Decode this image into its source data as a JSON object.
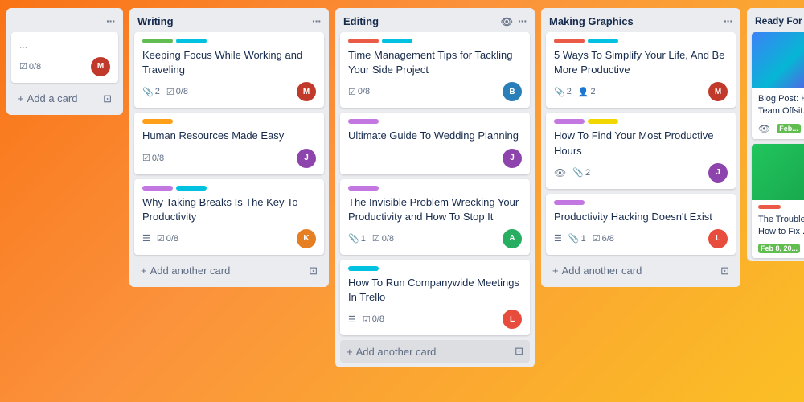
{
  "columns": [
    {
      "id": "col-left-partial",
      "title": "...",
      "partial": true,
      "cards": [
        {
          "labels": [],
          "title": "...",
          "badges": {
            "checks": "0/8"
          },
          "hasAvatar": true,
          "avatarColor": "#c0392b"
        }
      ],
      "addCardLabel": "Add a card"
    },
    {
      "id": "col-writing",
      "title": "Writing",
      "cards": [
        {
          "labels": [
            {
              "color": "green"
            },
            {
              "color": "teal"
            }
          ],
          "title": "Keeping Focus While Working and Traveling",
          "badges": {
            "paperclip": "2",
            "checks": "0/8"
          },
          "hasAvatar": true,
          "avatarColor": "#c0392b"
        },
        {
          "labels": [
            {
              "color": "orange"
            }
          ],
          "title": "Human Resources Made Easy",
          "badges": {
            "checks": "0/8"
          },
          "hasAvatar": true,
          "avatarColor": "#8e44ad"
        },
        {
          "labels": [
            {
              "color": "purple"
            },
            {
              "color": "teal"
            }
          ],
          "title": "Why Taking Breaks Is The Key To Productivity",
          "badges": {
            "list": true,
            "checks": "0/8"
          },
          "hasAvatar": true,
          "avatarColor": "#e67e22"
        }
      ],
      "addCardLabel": "Add another card"
    },
    {
      "id": "col-editing",
      "title": "Editing",
      "hasEye": true,
      "cards": [
        {
          "labels": [
            {
              "color": "red"
            },
            {
              "color": "teal"
            }
          ],
          "title": "Time Management Tips for Tackling Your Side Project",
          "badges": {
            "checks": "0/8"
          },
          "hasAvatar": true,
          "avatarColor": "#2980b9"
        },
        {
          "labels": [
            {
              "color": "purple"
            }
          ],
          "title": "Ultimate Guide To Wedding Planning",
          "badges": {
            "checks": ""
          },
          "hasAvatar": true,
          "avatarColor": "#8e44ad"
        },
        {
          "labels": [
            {
              "color": "purple"
            }
          ],
          "title": "The Invisible Problem Wrecking Your Productivity and How To Stop It",
          "badges": {
            "paperclip": "1",
            "checks": "0/8"
          },
          "hasAvatar": true,
          "avatarColor": "#27ae60"
        },
        {
          "labels": [
            {
              "color": "teal"
            }
          ],
          "title": "How To Run Companywide Meetings In Trello",
          "badges": {
            "list": true,
            "checks": "0/8"
          },
          "hasAvatar": true,
          "avatarColor": "#e74c3c"
        }
      ],
      "addCardLabel": "Add another card"
    },
    {
      "id": "col-making-graphics",
      "title": "Making Graphics",
      "cards": [
        {
          "labels": [
            {
              "color": "red"
            },
            {
              "color": "teal"
            }
          ],
          "title": "5 Ways To Simplify Your Life, And Be More Productive",
          "badges": {
            "paperclip": "2",
            "people": "2"
          },
          "hasAvatar": true,
          "avatarColor": "#c0392b"
        },
        {
          "labels": [
            {
              "color": "purple"
            },
            {
              "color": "yellow"
            }
          ],
          "title": "How To Find Your Most Productive Hours",
          "badges": {
            "eye": true,
            "paperclip": "2"
          },
          "hasAvatar": true,
          "avatarColor": "#8e44ad"
        },
        {
          "labels": [
            {
              "color": "purple"
            }
          ],
          "title": "Productivity Hacking Doesn't Exist",
          "badges": {
            "list": true,
            "paperclip": "1",
            "checks": "6/8"
          },
          "hasAvatar": true,
          "avatarColor": "#e74c3c"
        }
      ],
      "addCardLabel": "Add another card"
    },
    {
      "id": "col-ready",
      "title": "Ready For",
      "partial": true,
      "cards": [
        {
          "hasTopImage": true,
          "labels": [],
          "title": "Blog Post: H... Team Offsit...",
          "badges": {
            "eye": true,
            "greenBadge": "Feb..."
          },
          "hasAvatar": true,
          "avatarColor": "#2980b9"
        },
        {
          "hasTopImage": true,
          "labels": [
            {
              "color": "red"
            }
          ],
          "title": "The Trouble... How to Fix ...",
          "badges": {
            "greenBadge": "Feb 8, 20..."
          },
          "hasAvatar": false,
          "avatarColor": ""
        }
      ]
    }
  ],
  "icons": {
    "dots": "···",
    "plus": "+",
    "card-back": "⊡",
    "eye": "👁",
    "paperclip": "🖇",
    "check": "☑",
    "people": "👤",
    "list": "≡",
    "comment": "💬"
  }
}
